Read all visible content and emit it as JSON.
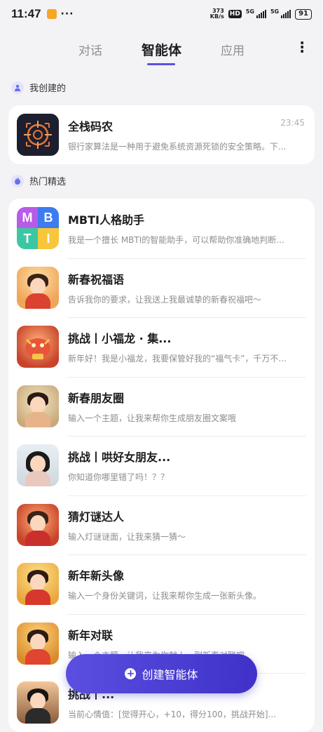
{
  "status_bar": {
    "time": "11:47",
    "net_speed_top": "373",
    "net_speed_unit": "KB/s",
    "hd": "HD",
    "sig1_label": "5G",
    "sig2_label": "5G",
    "battery": "91"
  },
  "tabs": [
    {
      "label": "对话",
      "active": false
    },
    {
      "label": "智能体",
      "active": true
    },
    {
      "label": "应用",
      "active": false
    }
  ],
  "sections": {
    "mine": "我创建的",
    "hot": "热门精选"
  },
  "my_agents": [
    {
      "title": "全栈码农",
      "desc": "银行家算法是一种用于避免系统资源死锁的安全策略。下...",
      "time": "23:45",
      "icon": "code-crosshair-icon"
    }
  ],
  "hot_agents": [
    {
      "title": "MBTI人格助手",
      "desc": "我是一个擅长 MBTI的智能助手，可以帮助你准确地判断...",
      "icon": "mbti-icon"
    },
    {
      "title": "新春祝福语",
      "desc": "告诉我你的要求，让我送上我最诚挚的新春祝福吧～",
      "icon": "girl-portrait"
    },
    {
      "title": "挑战丨小福龙 · 集...",
      "desc": "新年好！我是小福龙，我要保管好我的“福气卡”，千万不...",
      "icon": "dragon-portrait"
    },
    {
      "title": "新春朋友圈",
      "desc": "输入一个主题，让我来帮你生成朋友圈文案哦",
      "icon": "child-portrait"
    },
    {
      "title": "挑战丨哄好女朋友...",
      "desc": "你知道你哪里错了吗！？？",
      "icon": "woman-portrait"
    },
    {
      "title": "猜灯谜达人",
      "desc": "输入灯谜谜面，让我来猜一猜～",
      "icon": "boy-lantern-portrait"
    },
    {
      "title": "新年新头像",
      "desc": "输入一个身份关键词，让我来帮你生成一张新头像。",
      "icon": "girl-red-portrait"
    },
    {
      "title": "新年对联",
      "desc": "输入一个主题，让我来为你献上一副新春对联吧",
      "icon": "girl-hanfu-portrait"
    },
    {
      "title": "挑战丨...",
      "desc": "当前心情值：[觉得开心，+10，得分100，挑战开始]...",
      "icon": "man-portrait"
    }
  ],
  "fab": {
    "label": "创建智能体"
  },
  "colors": {
    "accent": "#5b4fe0",
    "background": "#f3f3f6"
  }
}
